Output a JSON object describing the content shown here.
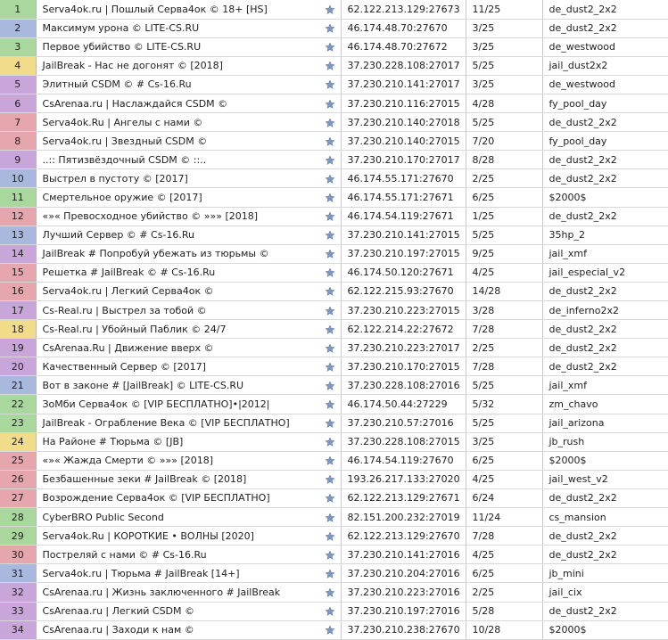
{
  "favorite_icon": "star-icon",
  "row_colors": {
    "green": "#a9d79e",
    "blue": "#a9b8dd",
    "yellow": "#f1dc8c",
    "purple": "#c9a6da",
    "red": "#e6a6ad"
  },
  "servers": [
    {
      "num": "1",
      "color": "green",
      "name": "Serva4ok.ru | Пошлый Серва4ок © 18+ [HS]",
      "address": "62.122.213.129:27673",
      "players": "11/25",
      "map": "de_dust2_2x2"
    },
    {
      "num": "2",
      "color": "blue",
      "name": "Максимум урона © LITE-CS.RU",
      "address": "46.174.48.70:27670",
      "players": "3/25",
      "map": "de_dust2_2x2"
    },
    {
      "num": "3",
      "color": "green",
      "name": "Первое убийство © LITE-CS.RU",
      "address": "46.174.48.70:27672",
      "players": "3/25",
      "map": "de_westwood"
    },
    {
      "num": "4",
      "color": "yellow",
      "name": "JailBreak - Нас не догонят © [2018]",
      "address": "37.230.228.108:27017",
      "players": "5/25",
      "map": "jail_dust2x2"
    },
    {
      "num": "5",
      "color": "purple",
      "name": "Элитный CSDM © # Cs-16.Ru",
      "address": "37.230.210.141:27017",
      "players": "3/25",
      "map": "de_westwood"
    },
    {
      "num": "6",
      "color": "purple",
      "name": "CsArenaa.ru | Наслаждайся CSDM ©",
      "address": "37.230.210.116:27015",
      "players": "4/28",
      "map": "fy_pool_day"
    },
    {
      "num": "7",
      "color": "red",
      "name": "Serva4ok.Ru | Ангелы с нами ©",
      "address": "37.230.210.140:27018",
      "players": "5/25",
      "map": "de_dust2_2x2"
    },
    {
      "num": "8",
      "color": "red",
      "name": "Serva4ok.ru | Звездный CSDM ©",
      "address": "37.230.210.140:27015",
      "players": "7/20",
      "map": "fy_pool_day"
    },
    {
      "num": "9",
      "color": "purple",
      "name": "..:: Пятизвёздочный CSDM © ::..",
      "address": "37.230.210.170:27017",
      "players": "8/28",
      "map": "de_dust2_2x2"
    },
    {
      "num": "10",
      "color": "blue",
      "name": "Выстрел в пустоту © [2017]",
      "address": "46.174.55.171:27670",
      "players": "2/25",
      "map": "de_dust2_2x2"
    },
    {
      "num": "11",
      "color": "green",
      "name": "Смертельное оружие © [2017]",
      "address": "46.174.55.171:27671",
      "players": "6/25",
      "map": "$2000$"
    },
    {
      "num": "12",
      "color": "red",
      "name": "«»« Превосходное убийство © »»» [2018]",
      "address": "46.174.54.119:27671",
      "players": "1/25",
      "map": "de_dust2_2x2"
    },
    {
      "num": "13",
      "color": "blue",
      "name": "Лучший Сервер © # Cs-16.Ru",
      "address": "37.230.210.141:27015",
      "players": "5/25",
      "map": "35hp_2"
    },
    {
      "num": "14",
      "color": "purple",
      "name": "JailBreak # Попробуй убежать из тюрьмы ©",
      "address": "37.230.210.197:27015",
      "players": "9/25",
      "map": "jail_xmf"
    },
    {
      "num": "15",
      "color": "red",
      "name": "Решетка # JailBreak © # Cs-16.Ru",
      "address": "46.174.50.120:27671",
      "players": "4/25",
      "map": "jail_especial_v2"
    },
    {
      "num": "16",
      "color": "red",
      "name": "Serva4ok.ru | Легкий Серва4ок ©",
      "address": "62.122.215.93:27670",
      "players": "14/28",
      "map": "de_dust2_2x2"
    },
    {
      "num": "17",
      "color": "purple",
      "name": "Cs-Real.ru | Выстрел за тобой ©",
      "address": "37.230.210.223:27015",
      "players": "3/28",
      "map": "de_inferno2x2"
    },
    {
      "num": "18",
      "color": "yellow",
      "name": "Cs-Real.ru | Убойный Паблик © 24/7",
      "address": "62.122.214.22:27672",
      "players": "7/28",
      "map": "de_dust2_2x2"
    },
    {
      "num": "19",
      "color": "purple",
      "name": "CsArenaa.Ru | Движение вверх ©",
      "address": "37.230.210.223:27017",
      "players": "2/25",
      "map": "de_dust2_2x2"
    },
    {
      "num": "20",
      "color": "purple",
      "name": "Качественный Сервер © [2017]",
      "address": "37.230.210.170:27015",
      "players": "7/28",
      "map": "de_dust2_2x2"
    },
    {
      "num": "21",
      "color": "blue",
      "name": "Вот в законе # [JailBreak] © LITE-CS.RU",
      "address": "37.230.228.108:27016",
      "players": "5/25",
      "map": "jail_xmf"
    },
    {
      "num": "22",
      "color": "green",
      "name": "ЗоМби Серва4ок © [VIP БЕСПЛАТНО]•|2012|",
      "address": "46.174.50.44:27229",
      "players": "5/32",
      "map": "zm_chavo"
    },
    {
      "num": "23",
      "color": "green",
      "name": "JailBreak - Ограбление Века © [VIP БЕСПЛАТНО]",
      "address": "37.230.210.57:27016",
      "players": "5/25",
      "map": "jail_arizona"
    },
    {
      "num": "24",
      "color": "yellow",
      "name": "На Районе # Тюрьма © [JB]",
      "address": "37.230.228.108:27015",
      "players": "3/25",
      "map": "jb_rush"
    },
    {
      "num": "25",
      "color": "red",
      "name": "«»« Жажда Смерти © »»» [2018]",
      "address": "46.174.54.119:27670",
      "players": "6/25",
      "map": "$2000$"
    },
    {
      "num": "26",
      "color": "red",
      "name": "Безбашенные зеки # JailBreak © [2018]",
      "address": "193.26.217.133:27020",
      "players": "4/25",
      "map": "jail_west_v2"
    },
    {
      "num": "27",
      "color": "red",
      "name": "Возрождение Серва4ок © [VIP БЕСПЛАТНО]",
      "address": "62.122.213.129:27671",
      "players": "6/24",
      "map": "de_dust2_2x2"
    },
    {
      "num": "28",
      "color": "green",
      "name": "CyberBRO Public Second",
      "address": "82.151.200.232:27019",
      "players": "11/24",
      "map": "cs_mansion"
    },
    {
      "num": "29",
      "color": "green",
      "name": "Serva4ok.Ru | КОРОТКИЕ • ВОЛНЫ [2020]",
      "address": "62.122.213.129:27670",
      "players": "7/28",
      "map": "de_dust2_2x2"
    },
    {
      "num": "30",
      "color": "red",
      "name": "Постреляй с нами © # Cs-16.Ru",
      "address": "37.230.210.141:27016",
      "players": "4/25",
      "map": "de_dust2_2x2"
    },
    {
      "num": "31",
      "color": "blue",
      "name": "Serva4ok.ru | Тюрьма # JailBreak [14+]",
      "address": "37.230.210.204:27016",
      "players": "6/25",
      "map": "jb_mini"
    },
    {
      "num": "32",
      "color": "purple",
      "name": "CsArenaa.ru | Жизнь заключенного # JailBreak",
      "address": "37.230.210.223:27016",
      "players": "2/25",
      "map": "jail_cix"
    },
    {
      "num": "33",
      "color": "purple",
      "name": "CsArenaa.ru | Легкий CSDM ©",
      "address": "37.230.210.197:27016",
      "players": "5/28",
      "map": "de_dust2_2x2"
    },
    {
      "num": "34",
      "color": "purple",
      "name": "CsArenaa.ru | Заходи к нам ©",
      "address": "37.230.210.238:27670",
      "players": "10/28",
      "map": "$2000$"
    }
  ]
}
